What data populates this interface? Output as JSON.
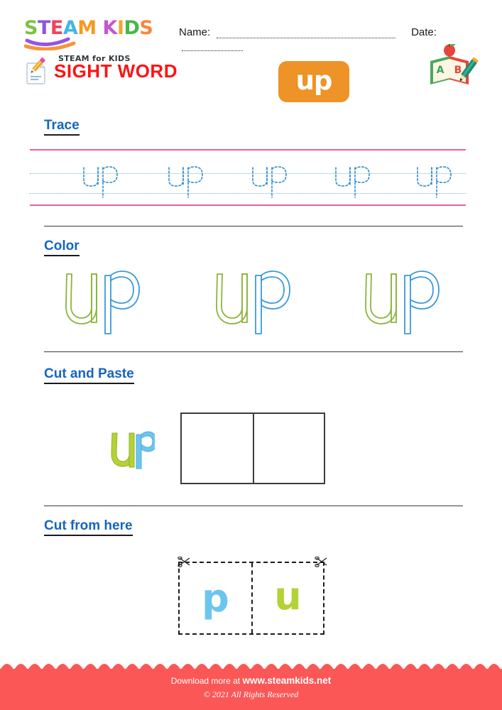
{
  "brand": {
    "logo_text": "STEAM KIDS",
    "logo_letters": [
      {
        "ch": "S",
        "color": "#7dc242"
      },
      {
        "ch": "T",
        "color": "#8e56d8"
      },
      {
        "ch": "E",
        "color": "#f0435e"
      },
      {
        "ch": "A",
        "color": "#41b6e6"
      },
      {
        "ch": "M",
        "color": "#f59a23"
      },
      {
        "ch": " ",
        "color": "#ffffff"
      },
      {
        "ch": "K",
        "color": "#c655d4"
      },
      {
        "ch": "I",
        "color": "#f5a623"
      },
      {
        "ch": "D",
        "color": "#48b749"
      },
      {
        "ch": "S",
        "color": "#f8873c"
      }
    ],
    "tagline": "STEAM for KIDS",
    "swoosh_purple": "#9b51e0",
    "swoosh_orange": "#f6953a"
  },
  "header": {
    "name_label": "Name:",
    "date_label": "Date:",
    "worksheet_title": "SIGHT WORD",
    "title_color": "#fb1414",
    "badge_word": "up",
    "badge_color": "#ee9327",
    "pencil_icon": "pencil-paper-icon",
    "book_icon": "abc-book-icon",
    "book_letters": [
      "A",
      "B"
    ]
  },
  "sections": [
    {
      "id": "trace",
      "heading": "Trace",
      "word": "up",
      "repetitions": 5,
      "guide_line_color": "#ef5d9e",
      "mid_line_color": "#76b6e0",
      "trace_stroke_color": "#2e8ccd"
    },
    {
      "id": "color",
      "heading": "Color",
      "word": "up",
      "repetitions": 3,
      "u_outline_color": "#8cb43c",
      "p_outline_color": "#3a9ad9"
    },
    {
      "id": "cut-and-paste",
      "heading": "Cut and Paste",
      "word": "up",
      "u_color": "#b3d236",
      "p_color": "#6bc6ef",
      "boxes": 2
    },
    {
      "id": "cut-from-here",
      "heading": "Cut from here",
      "cards": [
        {
          "letter": "p",
          "color": "#6bc6ef"
        },
        {
          "letter": "u",
          "color": "#b3d236"
        }
      ],
      "scissors_icon": "scissors-icon"
    }
  ],
  "footer": {
    "download_prefix": "Download more at",
    "website": "www.steamkids.net",
    "copyright": "© 2021 All Rights Reserved",
    "background_color": "#fb5757"
  }
}
